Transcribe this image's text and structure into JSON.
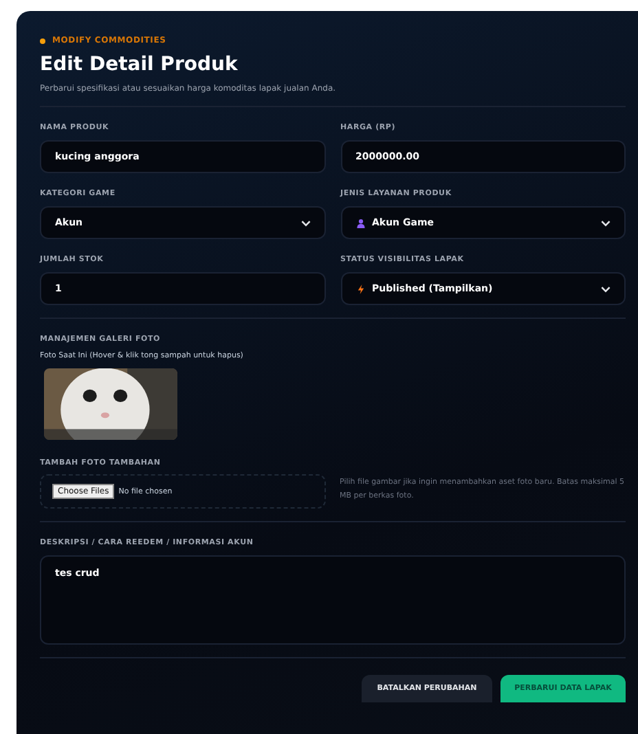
{
  "eyebrow": "MODIFY COMMODITIES",
  "title": "Edit Detail Produk",
  "subtitle": "Perbarui spesifikasi atau sesuaikan harga komoditas lapak jualan Anda.",
  "fields": [
    {
      "kind": "input",
      "label": "NAMA PRODUK",
      "value": "kucing anggora"
    },
    {
      "kind": "input",
      "label": "HARGA (RP)",
      "value": "2000000.00"
    },
    {
      "kind": "select",
      "label": "KATEGORI GAME",
      "value": "Akun"
    },
    {
      "kind": "service-select",
      "label": "JENIS LAYANAN PRODUK",
      "value": "Akun Game",
      "color": "#8b5cf6"
    },
    {
      "kind": "input",
      "label": "JUMLAH STOK",
      "value": "1"
    },
    {
      "kind": "status-select",
      "label": "STATUS VISIBILITAS LAPAK",
      "value": "Published (Tampilkan)",
      "color": "#f97316"
    }
  ],
  "gallery": {
    "label": "MANAJEMEN GALERI FOTO",
    "caption": "Foto Saat Ini (Hover & klik tong sampah untuk hapus)"
  },
  "upload": {
    "label": "TAMBAH FOTO TAMBAHAN",
    "button": "Choose Files",
    "status": "No file chosen",
    "hint": "Pilih file gambar jika ingin menambahkan aset foto baru. Batas maksimal 5 MB per berkas foto."
  },
  "description": {
    "label": "DESKRIPSI / CARA REEDEM / INFORMASI AKUN",
    "value": "tes crud"
  },
  "buttons": [
    {
      "kind": "secondary",
      "label": "BATALKAN PERUBAHAN"
    },
    {
      "kind": "primary",
      "label": "PERBARUI DATA LAPAK"
    }
  ]
}
